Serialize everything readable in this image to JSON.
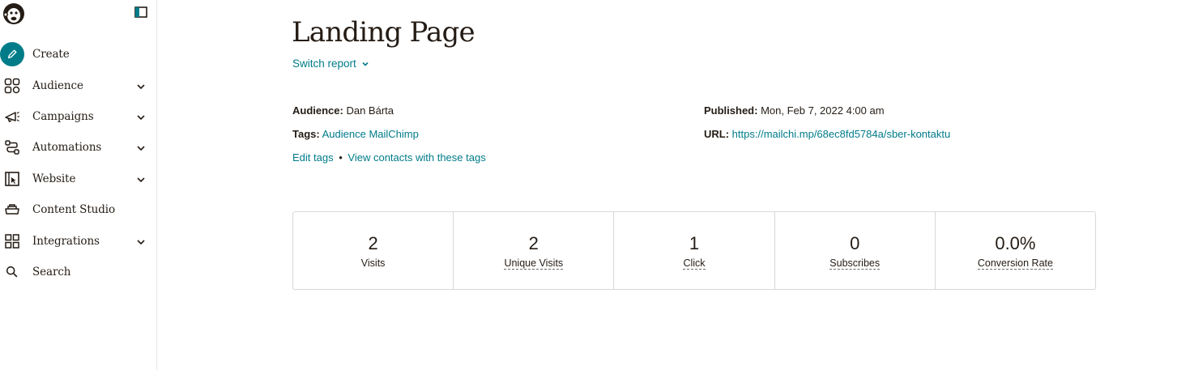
{
  "sidebar": {
    "items": [
      {
        "label": "Create",
        "icon": "pencil-icon",
        "chevron": false
      },
      {
        "label": "Audience",
        "icon": "audience-icon",
        "chevron": true
      },
      {
        "label": "Campaigns",
        "icon": "megaphone-icon",
        "chevron": true
      },
      {
        "label": "Automations",
        "icon": "automations-icon",
        "chevron": true
      },
      {
        "label": "Website",
        "icon": "website-icon",
        "chevron": true
      },
      {
        "label": "Content Studio",
        "icon": "content-studio-icon",
        "chevron": false
      },
      {
        "label": "Integrations",
        "icon": "integrations-icon",
        "chevron": true
      },
      {
        "label": "Search",
        "icon": "search-icon",
        "chevron": false
      }
    ]
  },
  "page": {
    "title": "Landing Page",
    "switch_report": "Switch report"
  },
  "meta": {
    "audience_label": "Audience:",
    "audience_value": "Dan Bárta",
    "tags_label": "Tags:",
    "tags_value": "Audience MailChimp",
    "edit_tags": "Edit tags",
    "separator": "•",
    "view_contacts": "View contacts with these tags",
    "published_label": "Published:",
    "published_value": "Mon, Feb 7, 2022 4:00 am",
    "url_label": "URL:",
    "url_value": "https://mailchi.mp/68ec8fd5784a/sber-kontaktu"
  },
  "stats": [
    {
      "value": "2",
      "label": "Visits"
    },
    {
      "value": "2",
      "label": "Unique Visits"
    },
    {
      "value": "1",
      "label": "Click"
    },
    {
      "value": "0",
      "label": "Subscribes"
    },
    {
      "value": "0.0%",
      "label": "Conversion Rate"
    }
  ],
  "colors": {
    "accent": "#007c89",
    "text": "#241c15",
    "border": "#d8d8d8"
  }
}
